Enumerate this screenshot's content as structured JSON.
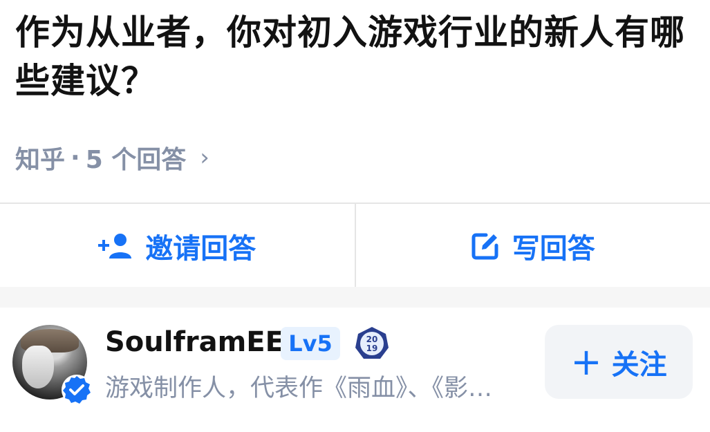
{
  "question": {
    "title": "作为从业者，你对初入游戏行业的新人有哪些建议？",
    "source": "知乎",
    "separator": "·",
    "answer_count": "5 个回答"
  },
  "actions": {
    "invite_label": "邀请回答",
    "write_label": "写回答"
  },
  "author": {
    "name": "SoulframEE",
    "level": "Lv5",
    "badge_year_top": "20",
    "badge_year_bottom": "19",
    "description": "游戏制作人，代表作《雨血》、《影…",
    "follow_label": "关注",
    "follow_plus": "+"
  },
  "colors": {
    "accent": "#1772f6",
    "muted": "#8590a6",
    "level_bg": "#e8f2fe",
    "follow_bg": "#f2f4f7"
  },
  "icons": {
    "invite": "add-user-icon",
    "write": "edit-icon",
    "verified": "verified-check-icon",
    "chevron": "chevron-right-icon"
  }
}
